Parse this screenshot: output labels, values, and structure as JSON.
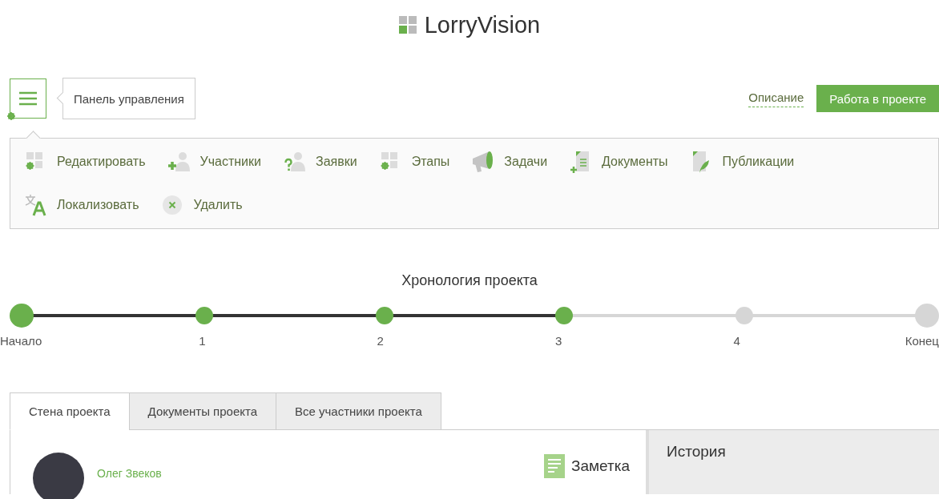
{
  "logo": {
    "text": "LorryVision"
  },
  "menu_tooltip": "Панель управления",
  "top_links": {
    "link": "Описание",
    "button": "Работа в проекте"
  },
  "actions": [
    {
      "label": "Редактировать"
    },
    {
      "label": "Участники"
    },
    {
      "label": "Заявки"
    },
    {
      "label": "Этапы"
    },
    {
      "label": "Задачи"
    },
    {
      "label": "Документы"
    },
    {
      "label": "Публикации"
    },
    {
      "label": "Локализовать"
    },
    {
      "label": "Удалить"
    }
  ],
  "timeline": {
    "title": "Хронология проекта",
    "points": [
      {
        "label": "Начало",
        "done": true,
        "kind": "end"
      },
      {
        "label": "1",
        "done": true,
        "kind": "stage"
      },
      {
        "label": "2",
        "done": true,
        "kind": "stage"
      },
      {
        "label": "3",
        "done": true,
        "kind": "stage"
      },
      {
        "label": "4",
        "done": false,
        "kind": "stage"
      },
      {
        "label": "Конец",
        "done": false,
        "kind": "end"
      }
    ]
  },
  "tabs": [
    {
      "label": "Стена проекта",
      "selected": true
    },
    {
      "label": "Документы проекта",
      "selected": false
    },
    {
      "label": "Все участники проекта",
      "selected": false
    }
  ],
  "post": {
    "author": "Олег Звеков",
    "note_button": "Заметка"
  },
  "history": {
    "title": "История"
  }
}
